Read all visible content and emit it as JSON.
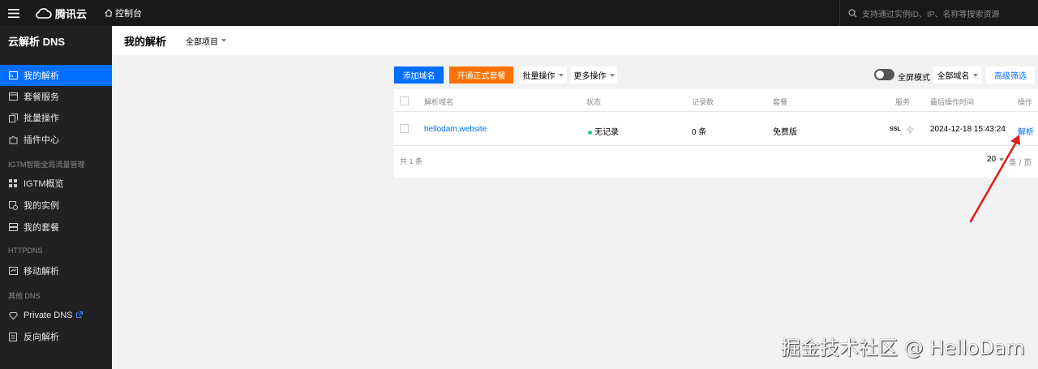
{
  "topbar": {
    "logo": "腾讯云",
    "console": "控制台",
    "search_placeholder": "支持通过实例ID、IP、名称等搜索资源"
  },
  "sidebar": {
    "title": "云解析 DNS",
    "items": [
      {
        "label": "我的解析",
        "icon": "dns-list-icon",
        "active": true
      },
      {
        "label": "套餐服务",
        "icon": "package-icon"
      },
      {
        "label": "批量操作",
        "icon": "batch-icon"
      },
      {
        "label": "插件中心",
        "icon": "plugin-icon"
      }
    ],
    "group_igtm": "IGTM智能全局流量管理",
    "igtm_items": [
      {
        "label": "IGTM概览",
        "icon": "grid-icon"
      },
      {
        "label": "我的实例",
        "icon": "instance-icon"
      },
      {
        "label": "我的套餐",
        "icon": "package-list-icon"
      }
    ],
    "group_httpdns": "HTTPDNS",
    "httpdns_items": [
      {
        "label": "移动解析",
        "icon": "mobile-dns-icon"
      }
    ],
    "group_other": "其他 DNS",
    "other_items": [
      {
        "label": "Private DNS",
        "icon": "diamond-icon"
      },
      {
        "label": "反向解析",
        "icon": "reverse-icon"
      }
    ]
  },
  "header": {
    "title": "我的解析",
    "project_select": "全部项目"
  },
  "toolbar": {
    "add_domain": "添加域名",
    "open_package": "开通正式套餐",
    "batch_ops": "批量操作",
    "more_ops": "更多操作",
    "fullscreen": "全屏模式",
    "domain_filter": "全部域名",
    "advanced_filter": "高级筛选"
  },
  "table": {
    "headers": {
      "domain": "解析域名",
      "status": "状态",
      "records": "记录数",
      "package": "套餐",
      "service": "服务",
      "last_op": "最后操作时间",
      "actions": "操作"
    },
    "rows": [
      {
        "domain": "hellodam.website",
        "status": "无记录",
        "records": "0 条",
        "package": "免费版",
        "service": "SSL",
        "last_op": "2024-12-18 15:43:24",
        "action": "解析"
      }
    ],
    "footer_total": "共 1 条",
    "page_size": "20",
    "per_page": "条 / 页"
  },
  "colors": {
    "primary": "#006eff",
    "orange": "#ff7200",
    "status_green": "#29cc85",
    "annotation_red": "#e01e1e"
  },
  "watermark": "掘金技术社区 @ HelloDam"
}
